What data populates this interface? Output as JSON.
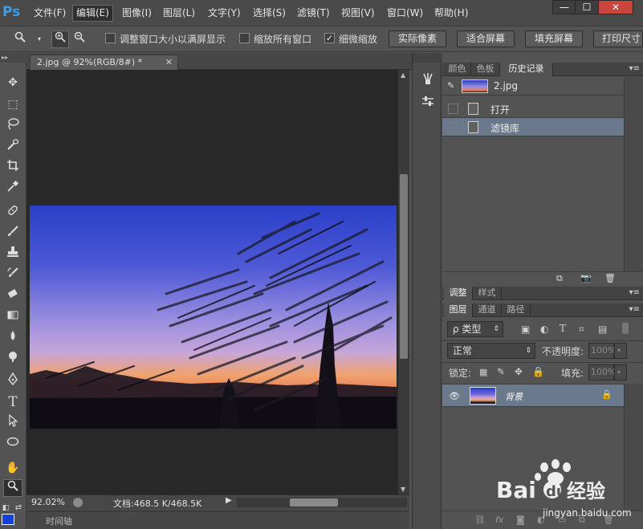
{
  "app": {
    "logo": "Ps"
  },
  "menu": {
    "items": [
      "文件(F)",
      "编辑(E)",
      "图像(I)",
      "图层(L)",
      "文字(Y)",
      "选择(S)",
      "滤镜(T)",
      "视图(V)",
      "窗口(W)",
      "帮助(H)"
    ],
    "active_index": 1
  },
  "window_controls": {
    "minimize": "—",
    "maximize": "☐",
    "close": "✕"
  },
  "options_bar": {
    "resize_windows_label": "调整窗口大小以满屏显示",
    "resize_windows_checked": false,
    "zoom_all_label": "缩放所有窗口",
    "zoom_all_checked": false,
    "scrubby_zoom_label": "细微缩放",
    "scrubby_zoom_checked": true,
    "checkmark": "✓",
    "buttons": [
      "实际像素",
      "适合屏幕",
      "填充屏幕",
      "打印尺寸"
    ]
  },
  "document": {
    "tab_title": "2.jpg @ 92%(RGB/8#) *",
    "zoom": "92.02%",
    "doc_size": "文档:468.5 K/468.5K",
    "timeline_label": "时间轴"
  },
  "colors": {
    "foreground": "#1a3fd8",
    "accent_blue": "#3d9be6",
    "selected_row": "#6a7a8c",
    "close_button": "#c9463d"
  },
  "panels": {
    "top_tabs": [
      "颜色",
      "色板",
      "历史记录"
    ],
    "top_active": 2,
    "history": {
      "snapshot_name": "2.jpg",
      "states": [
        {
          "label": "打开",
          "selected": false
        },
        {
          "label": "滤镜库",
          "selected": true
        }
      ]
    },
    "mid_tabs": [
      "调整",
      "样式"
    ],
    "mid_active": 0,
    "layers_tabs": [
      "图层",
      "通道",
      "路径"
    ],
    "layers_active": 0,
    "filter_kind": "ρ 类型",
    "blend_mode": "正常",
    "opacity_label": "不透明度:",
    "opacity_value": "100%",
    "lock_label": "锁定:",
    "fill_label": "填充:",
    "fill_value": "100%",
    "layer_name": "背景"
  },
  "icons": {
    "toolbar": [
      "move-icon",
      "marquee-icon",
      "lasso-icon",
      "quick-select-icon",
      "crop-icon",
      "eyedropper-icon",
      "healing-brush-icon",
      "brush-icon",
      "clone-stamp-icon",
      "history-brush-icon",
      "eraser-icon",
      "gradient-icon",
      "blur-icon",
      "dodge-icon",
      "pen-icon",
      "type-icon",
      "path-select-icon",
      "ellipse-icon",
      "hand-icon",
      "zoom-icon"
    ]
  },
  "watermark": {
    "url": "jingyan.baidu.com"
  }
}
